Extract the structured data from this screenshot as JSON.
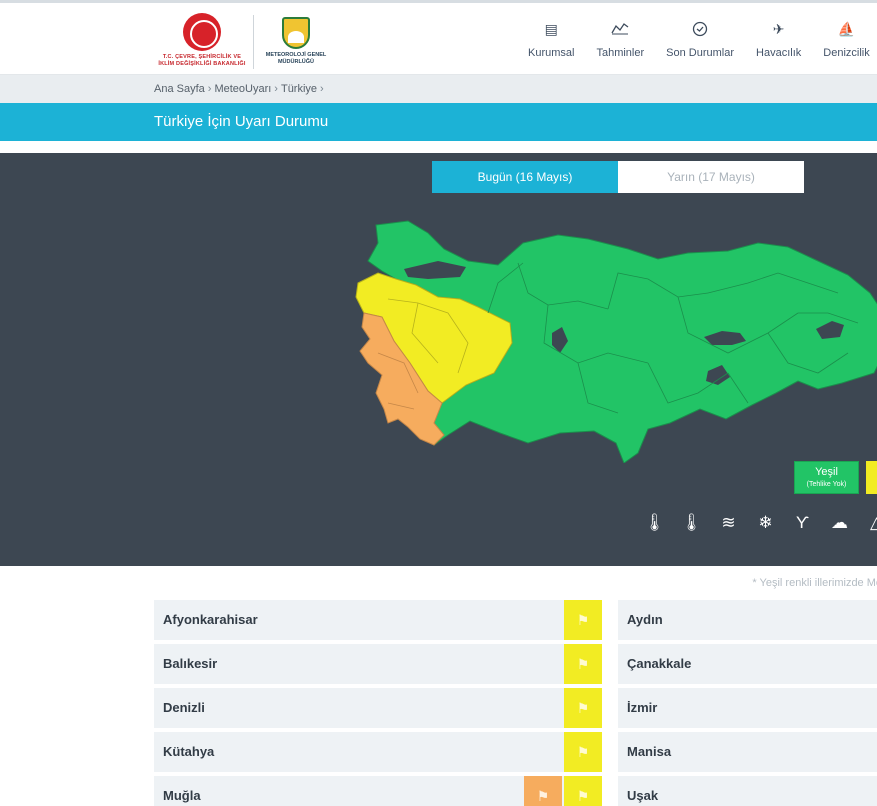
{
  "header": {
    "ministry_logo_text": "T.C. ÇEVRE, ŞEHİRCİLİK VE İKLİM DEĞİŞİKLİĞİ BAKANLIĞI",
    "mgm_logo_top": "METEOROLOJİ",
    "mgm_logo_text": "METEOROLOJİ GENEL MÜDÜRLÜĞÜ",
    "nav": [
      {
        "label": "Kurumsal",
        "icon": "document-icon"
      },
      {
        "label": "Tahminler",
        "icon": "chart-icon"
      },
      {
        "label": "Son Durumlar",
        "icon": "clock-icon"
      },
      {
        "label": "Havacılık",
        "icon": "plane-icon"
      },
      {
        "label": "Denizcilik",
        "icon": "ship-icon"
      }
    ]
  },
  "breadcrumb": [
    "Ana Sayfa",
    "MeteoUyarı",
    "Türkiye"
  ],
  "page_title": "Türkiye İçin Uyarı Durumu",
  "tabs": {
    "today": "Bugün (16 Mayıs)",
    "tomorrow": "Yarın (17 Mayıs)"
  },
  "legend": {
    "green_label": "Yeşil",
    "green_sub": "(Tehlike Yok)",
    "colors": {
      "green": "#22c466",
      "yellow": "#f2ec23",
      "orange": "#f6ac5e"
    }
  },
  "hazard_icons": [
    "cold-icon",
    "hot-icon",
    "wind-icon",
    "snow-icon",
    "storm-icon",
    "fog-icon",
    "avalanche-icon"
  ],
  "note": "* Yeşil renkli illerimizde Meteorolojik Uyarı ol",
  "provinces_left": [
    {
      "name": "Afyonkarahisar",
      "warnings": [
        "yellow"
      ]
    },
    {
      "name": "Balıkesir",
      "warnings": [
        "yellow"
      ]
    },
    {
      "name": "Denizli",
      "warnings": [
        "yellow"
      ]
    },
    {
      "name": "Kütahya",
      "warnings": [
        "yellow"
      ]
    },
    {
      "name": "Muğla",
      "warnings": [
        "orange",
        "yellow"
      ]
    }
  ],
  "provinces_right": [
    {
      "name": "Aydın"
    },
    {
      "name": "Çanakkale"
    },
    {
      "name": "İzmir"
    },
    {
      "name": "Manisa"
    },
    {
      "name": "Uşak"
    }
  ]
}
